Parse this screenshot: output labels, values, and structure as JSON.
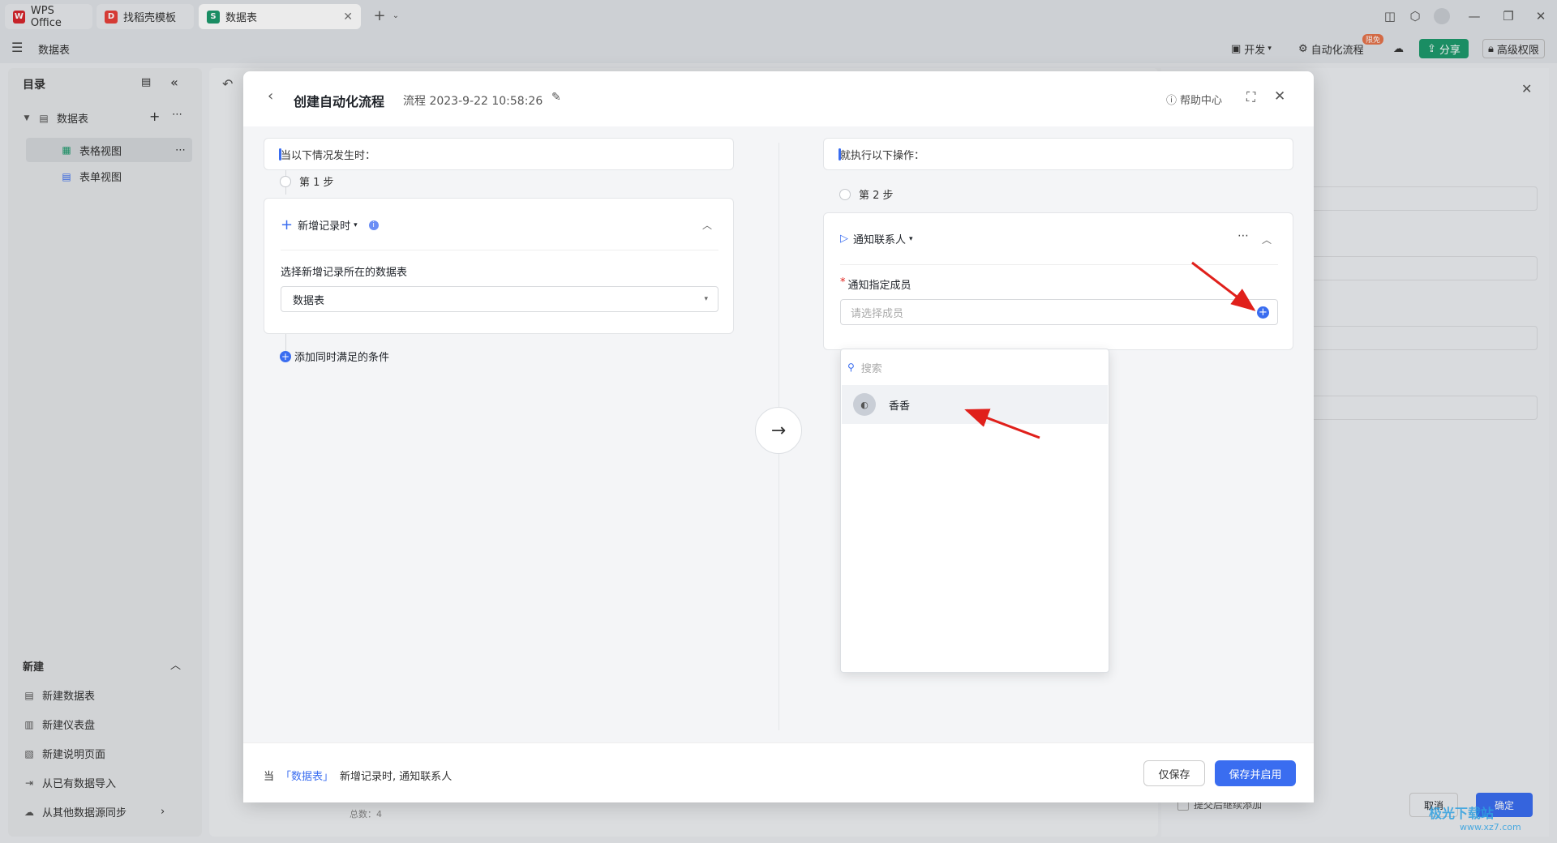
{
  "browser": {
    "tabs": [
      {
        "label": "WPS Office"
      },
      {
        "label": "找稻壳模板"
      },
      {
        "label": "数据表"
      }
    ]
  },
  "app": {
    "doc_name": "数据表",
    "toolbar": {
      "dev": "开发",
      "automation": "自动化流程",
      "automation_badge": "限免",
      "share": "分享",
      "permissions": "高级权限"
    }
  },
  "sidebar": {
    "title": "目录",
    "tree": {
      "root": "数据表",
      "children": [
        {
          "label": "表格视图"
        },
        {
          "label": "表单视图"
        }
      ]
    },
    "new_section": {
      "title": "新建",
      "items": [
        {
          "label": "新建数据表"
        },
        {
          "label": "新建仪表盘"
        },
        {
          "label": "新建说明页面"
        },
        {
          "label": "从已有数据导入"
        },
        {
          "label": "从其他数据源同步"
        }
      ]
    }
  },
  "background": {
    "total": "总数：4",
    "submit_continue": "提交后继续添加",
    "cancel": "取消",
    "confirm": "确定"
  },
  "modal": {
    "title": "创建自动化流程",
    "subtitle": "流程 2023-9-22 10:58:26",
    "help": "帮助中心",
    "trigger": {
      "header": "当以下情况发生时：",
      "step": "第 1 步",
      "event": "新增记录时",
      "field_label": "选择新增记录所在的数据表",
      "field_value": "数据表",
      "add_condition": "添加同时满足的条件"
    },
    "action": {
      "header": "就执行以下操作：",
      "step": "第 2 步",
      "type": "通知联系人",
      "required_mark": "*",
      "field_label": "通知指定成员",
      "placeholder": "请选择成员",
      "search_placeholder": "搜索",
      "members": [
        {
          "name": "香香"
        }
      ]
    },
    "footer": {
      "prefix": "当",
      "table_link": "「数据表」",
      "suffix": "新增记录时, 通知联系人",
      "save_only": "仅保存",
      "save_enable": "保存并启用"
    }
  },
  "watermark": {
    "text": "极光下载站",
    "url": "www.xz7.com"
  },
  "colors": {
    "primary": "#3a6df0",
    "share_green": "#1d9a6c",
    "annotation_red": "#e0201b"
  }
}
